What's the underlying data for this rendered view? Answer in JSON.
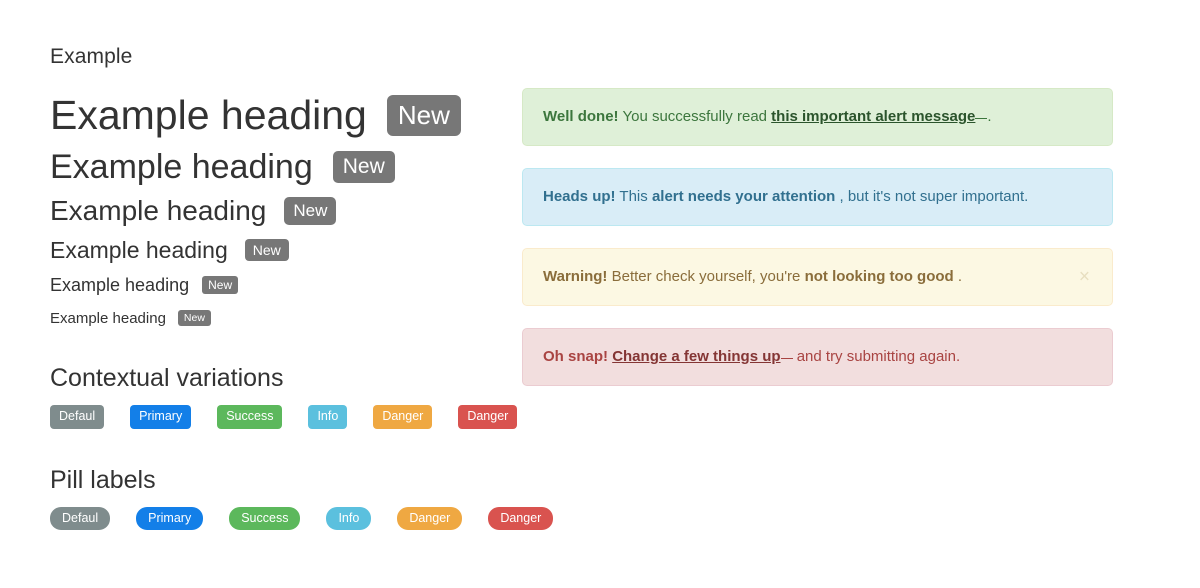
{
  "left": {
    "eyebrow": "Example",
    "headings": [
      {
        "text": "Example heading",
        "badge": "New"
      },
      {
        "text": "Example heading",
        "badge": "New"
      },
      {
        "text": "Example heading",
        "badge": "New"
      },
      {
        "text": "Example heading",
        "badge": "New"
      },
      {
        "text": "Example heading",
        "badge": "New"
      },
      {
        "text": "Example heading",
        "badge": "New"
      }
    ],
    "contextual": {
      "title": "Contextual variations",
      "labels": [
        {
          "text": "Defaul",
          "color": "#7f8c8d"
        },
        {
          "text": "Primary",
          "color": "#137fe8"
        },
        {
          "text": "Success",
          "color": "#5cb85c"
        },
        {
          "text": "Info",
          "color": "#5bc0de"
        },
        {
          "text": "Danger",
          "color": "#efa842"
        },
        {
          "text": "Danger",
          "color": "#d9534f"
        }
      ]
    },
    "pills": {
      "title": "Pill labels",
      "labels": [
        {
          "text": "Defaul",
          "color": "#7f8c8d"
        },
        {
          "text": "Primary",
          "color": "#137fe8"
        },
        {
          "text": "Success",
          "color": "#5cb85c"
        },
        {
          "text": "Info",
          "color": "#5bc0de"
        },
        {
          "text": "Danger",
          "color": "#efa842"
        },
        {
          "text": "Danger",
          "color": "#d9534f"
        }
      ]
    }
  },
  "alerts": [
    {
      "type": "success",
      "strong": "Well done!",
      "before": "You successfully read",
      "link": "this important alert message",
      "after": ".",
      "dismissible": false,
      "close_label": "×",
      "bg": "#dff0d8",
      "fg": "#3c763d"
    },
    {
      "type": "info",
      "strong": "Heads up!",
      "before": "This",
      "link": "alert needs your attention",
      "after": ", but it's not super important.",
      "dismissible": false,
      "close_label": "×",
      "bg": "#d9edf7",
      "fg": "#31708f"
    },
    {
      "type": "warning",
      "strong": "Warning!",
      "before": "Better check yourself, you're",
      "link": "not looking too good",
      "after": ".",
      "dismissible": true,
      "close_label": "×",
      "bg": "#fcf8e3",
      "fg": "#8a6d3b"
    },
    {
      "type": "danger",
      "strong": "Oh snap!",
      "before": "",
      "link": "Change a few things up",
      "after": "and try submitting again.",
      "dismissible": false,
      "close_label": "×",
      "bg": "#f2dede",
      "fg": "#a94442"
    }
  ]
}
